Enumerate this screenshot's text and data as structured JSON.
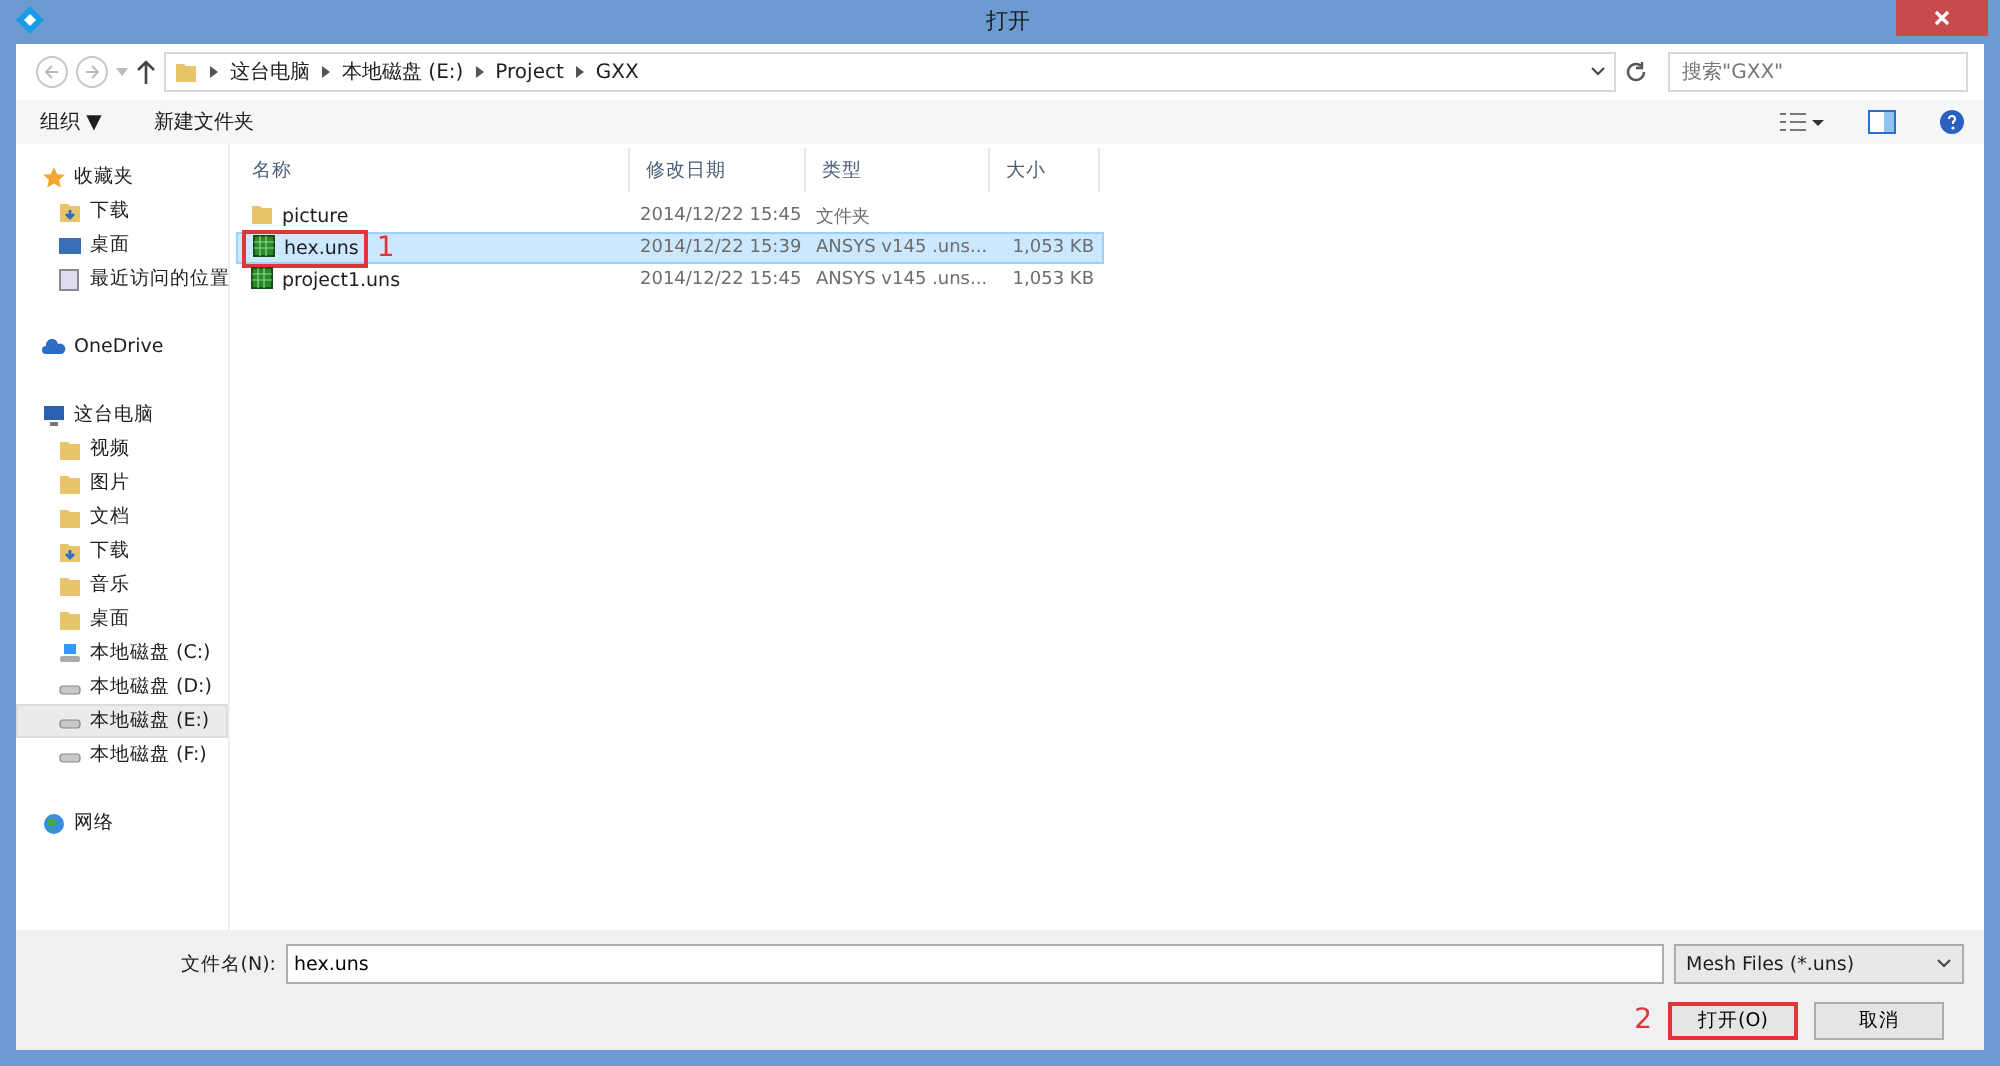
{
  "window": {
    "title": "打开"
  },
  "address": {
    "path": [
      "这台电脑",
      "本地磁盘 (E:)",
      "Project",
      "GXX"
    ],
    "search_placeholder": "搜索\"GXX\""
  },
  "toolbar": {
    "organize": "组织 ▼",
    "new_folder": "新建文件夹"
  },
  "sidebar": [
    {
      "label": "收藏夹",
      "kind": "star",
      "selected": false,
      "children": [
        {
          "label": "下载",
          "kind": "download",
          "selected": false
        },
        {
          "label": "桌面",
          "kind": "desktop",
          "selected": false
        },
        {
          "label": "最近访问的位置",
          "kind": "recent",
          "selected": false
        }
      ]
    },
    {
      "label": "OneDrive",
      "kind": "cloud",
      "selected": false
    },
    {
      "label": "这台电脑",
      "kind": "pc",
      "selected": false,
      "children": [
        {
          "label": "视频",
          "kind": "folder",
          "selected": false
        },
        {
          "label": "图片",
          "kind": "folder",
          "selected": false
        },
        {
          "label": "文档",
          "kind": "folder",
          "selected": false
        },
        {
          "label": "下载",
          "kind": "download",
          "selected": false
        },
        {
          "label": "音乐",
          "kind": "folder",
          "selected": false
        },
        {
          "label": "桌面",
          "kind": "folder",
          "selected": false
        },
        {
          "label": "本地磁盘 (C:)",
          "kind": "sysdrive",
          "selected": false
        },
        {
          "label": "本地磁盘 (D:)",
          "kind": "drive",
          "selected": false
        },
        {
          "label": "本地磁盘 (E:)",
          "kind": "drive",
          "selected": true
        },
        {
          "label": "本地磁盘 (F:)",
          "kind": "drive",
          "selected": false
        }
      ]
    },
    {
      "label": "网络",
      "kind": "network",
      "selected": false
    }
  ],
  "table": {
    "columns": [
      "名称",
      "修改日期",
      "类型",
      "大小"
    ],
    "rows": [
      {
        "kind": "folder",
        "name": "picture",
        "date": "2014/12/22 15:45",
        "type": "文件夹",
        "selected": false
      },
      {
        "kind": "file",
        "name": "hex.uns",
        "date": "2014/12/22 15:39",
        "type": "ANSYS v145 .uns...",
        "size": "1,053 KB",
        "selected": true,
        "annotation": "1"
      },
      {
        "kind": "file",
        "name": "project1.uns",
        "date": "2014/12/22 15:45",
        "type": "ANSYS v145 .uns...",
        "size": "1,053 KB",
        "selected": false
      }
    ]
  },
  "footer": {
    "filename_label": "文件名(N):",
    "filename": "hex.uns",
    "filetype": "Mesh Files (*.uns)",
    "buttons": [
      {
        "label": "打开(O)",
        "annotation": "2"
      },
      {
        "label": "取消"
      }
    ]
  }
}
